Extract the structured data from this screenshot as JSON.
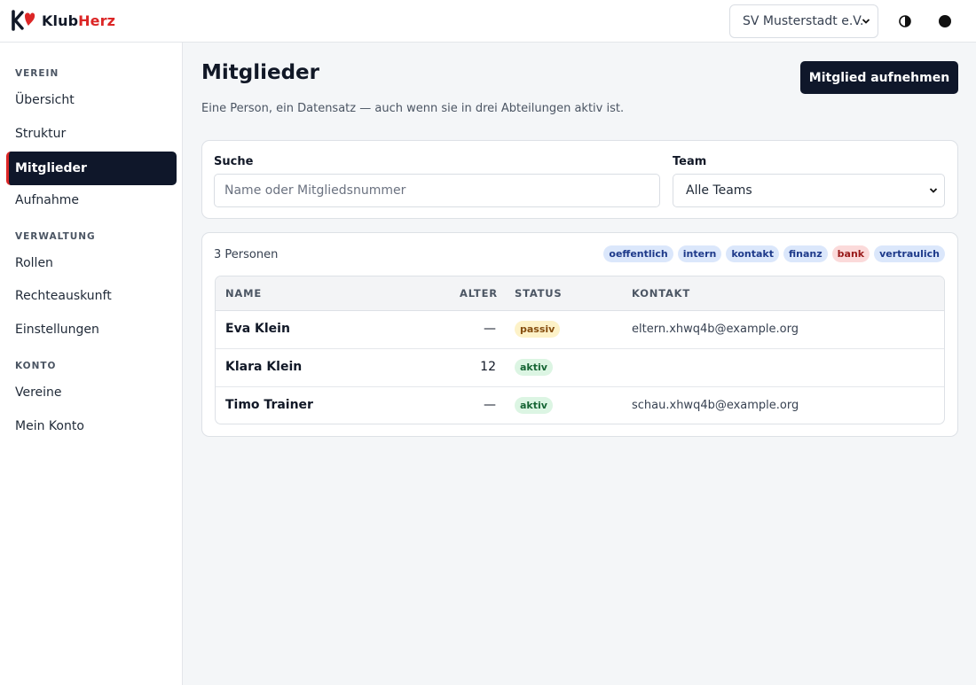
{
  "app": {
    "brand_part1": "Klub",
    "brand_part2": "Herz",
    "accent_color": "#dc2626",
    "dark_color": "#0f172a"
  },
  "header": {
    "club_select": "SV Musterstadt e.V.",
    "theme_icon": "contrast-icon",
    "user_icon": "user-dot-icon"
  },
  "sidebar": {
    "sections": [
      {
        "label": "VEREIN",
        "items": [
          "Übersicht",
          "Struktur",
          "Mitglieder",
          "Aufnahme"
        ]
      },
      {
        "label": "VERWALTUNG",
        "items": [
          "Rollen",
          "Rechteauskunft",
          "Einstellungen"
        ]
      },
      {
        "label": "KONTO",
        "items": [
          "Vereine",
          "Mein Konto"
        ]
      }
    ],
    "active_item": "Mitglieder"
  },
  "page": {
    "title": "Mitglieder",
    "add_button": "Mitglied aufnehmen",
    "subtitle": "Eine Person, ein Datensatz — auch wenn sie in drei Abteilungen aktiv ist."
  },
  "filters": {
    "search_label": "Suche",
    "search_placeholder": "Name oder Mitgliedsnummer",
    "search_value": "",
    "team_label": "Team",
    "team_value": "Alle Teams"
  },
  "list": {
    "count": "3 Personen",
    "tags": [
      {
        "label": "oeffentlich",
        "tone": "blue"
      },
      {
        "label": "intern",
        "tone": "blue"
      },
      {
        "label": "kontakt",
        "tone": "blue"
      },
      {
        "label": "finanz",
        "tone": "blue"
      },
      {
        "label": "bank",
        "tone": "red"
      },
      {
        "label": "vertraulich",
        "tone": "blue"
      }
    ],
    "columns": {
      "name": "NAME",
      "age": "ALTER",
      "status": "STATUS",
      "contact": "KONTAKT"
    },
    "rows": [
      {
        "name": "Eva Klein",
        "age": "—",
        "status": "passiv",
        "contact": "eltern.xhwq4b@example.org"
      },
      {
        "name": "Klara Klein",
        "age": "12",
        "status": "aktiv",
        "contact": ""
      },
      {
        "name": "Timo Trainer",
        "age": "—",
        "status": "aktiv",
        "contact": "schau.xhwq4b@example.org"
      }
    ]
  }
}
